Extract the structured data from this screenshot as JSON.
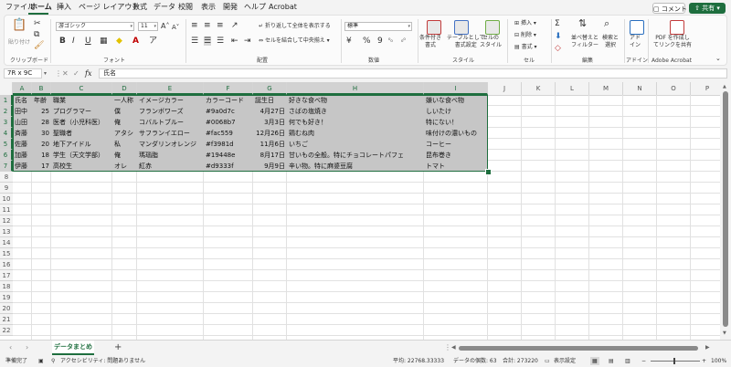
{
  "menu": {
    "tabs": [
      "ファイル",
      "ホーム",
      "挿入",
      "ページ レイアウト",
      "数式",
      "データ",
      "校閲",
      "表示",
      "開発",
      "ヘルプ",
      "Acrobat"
    ],
    "comment_label": "コメント",
    "share_label": "共有"
  },
  "ribbon": {
    "clipboard": {
      "paste_label": "貼り付け",
      "group_label": "クリップボード"
    },
    "font": {
      "font_name": "游ゴシック",
      "font_size": "11",
      "bold": "B",
      "italic": "I",
      "underline": "U",
      "grow": "A",
      "shrink": "A",
      "group_label": "フォント"
    },
    "alignment": {
      "wrap_label": "折り返して全体を表示する",
      "merge_label": "セルを結合して中央揃え",
      "group_label": "配置"
    },
    "number": {
      "format": "標準",
      "percent": "%",
      "comma": "9",
      "group_label": "数値"
    },
    "styles": {
      "conditional_label": "条件付き\n書式",
      "table_label": "テーブルとして\n書式設定",
      "cell_styles_label": "セルの\nスタイル",
      "group_label": "スタイル"
    },
    "cells": {
      "insert_label": "挿入",
      "delete_label": "削除",
      "format_label": "書式",
      "group_label": "セル"
    },
    "editing": {
      "sort_label": "並べ替えと\nフィルター",
      "find_label": "検索と\n選択",
      "group_label": "編集"
    },
    "addins": {
      "label": "アド\nイン",
      "group_label": "アドイン"
    },
    "acrobat": {
      "label": "PDF を作成し\nてリンクを共有",
      "group_label": "Adobe Acrobat"
    }
  },
  "formula_bar": {
    "name_box": "7R x 9C",
    "fx": "fx",
    "content": "氏名"
  },
  "grid": {
    "columns": [
      "A",
      "B",
      "C",
      "D",
      "E",
      "F",
      "G",
      "H",
      "I",
      "J",
      "K",
      "L",
      "M",
      "N",
      "O",
      "P"
    ],
    "rows": [
      "1",
      "2",
      "3",
      "4",
      "5",
      "6",
      "7",
      "8",
      "9",
      "10",
      "11",
      "12",
      "13",
      "14",
      "15",
      "16",
      "17",
      "18",
      "19",
      "20",
      "21",
      "22"
    ],
    "table": [
      [
        "氏名",
        "年齢",
        "職業",
        "一人称",
        "イメージカラー",
        "カラーコード",
        "誕生日",
        "好きな食べ物",
        "嫌いな食べ物"
      ],
      [
        "田中",
        "25",
        "プログラマー",
        "僕",
        "フランボワーズ",
        "#9a0d7c",
        "4月27日",
        "さばの塩焼き",
        "しいたけ"
      ],
      [
        "山田",
        "28",
        "医者（小児科医）",
        "俺",
        "コバルトブルー",
        "#0068b7",
        "3月3日",
        "何でも好き！",
        "特にない！"
      ],
      [
        "斉藤",
        "30",
        "聖職者",
        "アタシ",
        "サフランイエロー",
        "#fac559",
        "12月26日",
        "鶏むね肉",
        "味付けの濃いもの"
      ],
      [
        "佐藤",
        "20",
        "地下アイドル",
        "私",
        "マンダリンオレンジ",
        "#f3981d",
        "11月6日",
        "いちご",
        "コーヒー"
      ],
      [
        "加藤",
        "18",
        "学生（天文学部）",
        "俺",
        "瑪瑙脂",
        "#19448e",
        "8月17日",
        "甘いもの全般。特にチョコレートパフェ",
        "昆布巻き"
      ],
      [
        "伊藤",
        "17",
        "高校生",
        "オレ",
        "紅赤",
        "#d9333f",
        "9月9日",
        "辛い物。特に麻婆豆腐",
        "トマト"
      ]
    ]
  },
  "sheet_tabs": {
    "active": "データまとめ",
    "add": "+"
  },
  "status": {
    "ready": "準備完了",
    "accessibility": "アクセシビリティ: 問題ありません",
    "average": "平均: 22768.33333",
    "count": "データの個数: 63",
    "sum": "合計: 273220",
    "display_settings": "表示設定",
    "zoom": "100%"
  },
  "colors": {
    "accent": "#1e6e3e",
    "selection": "#c6c6c6"
  }
}
